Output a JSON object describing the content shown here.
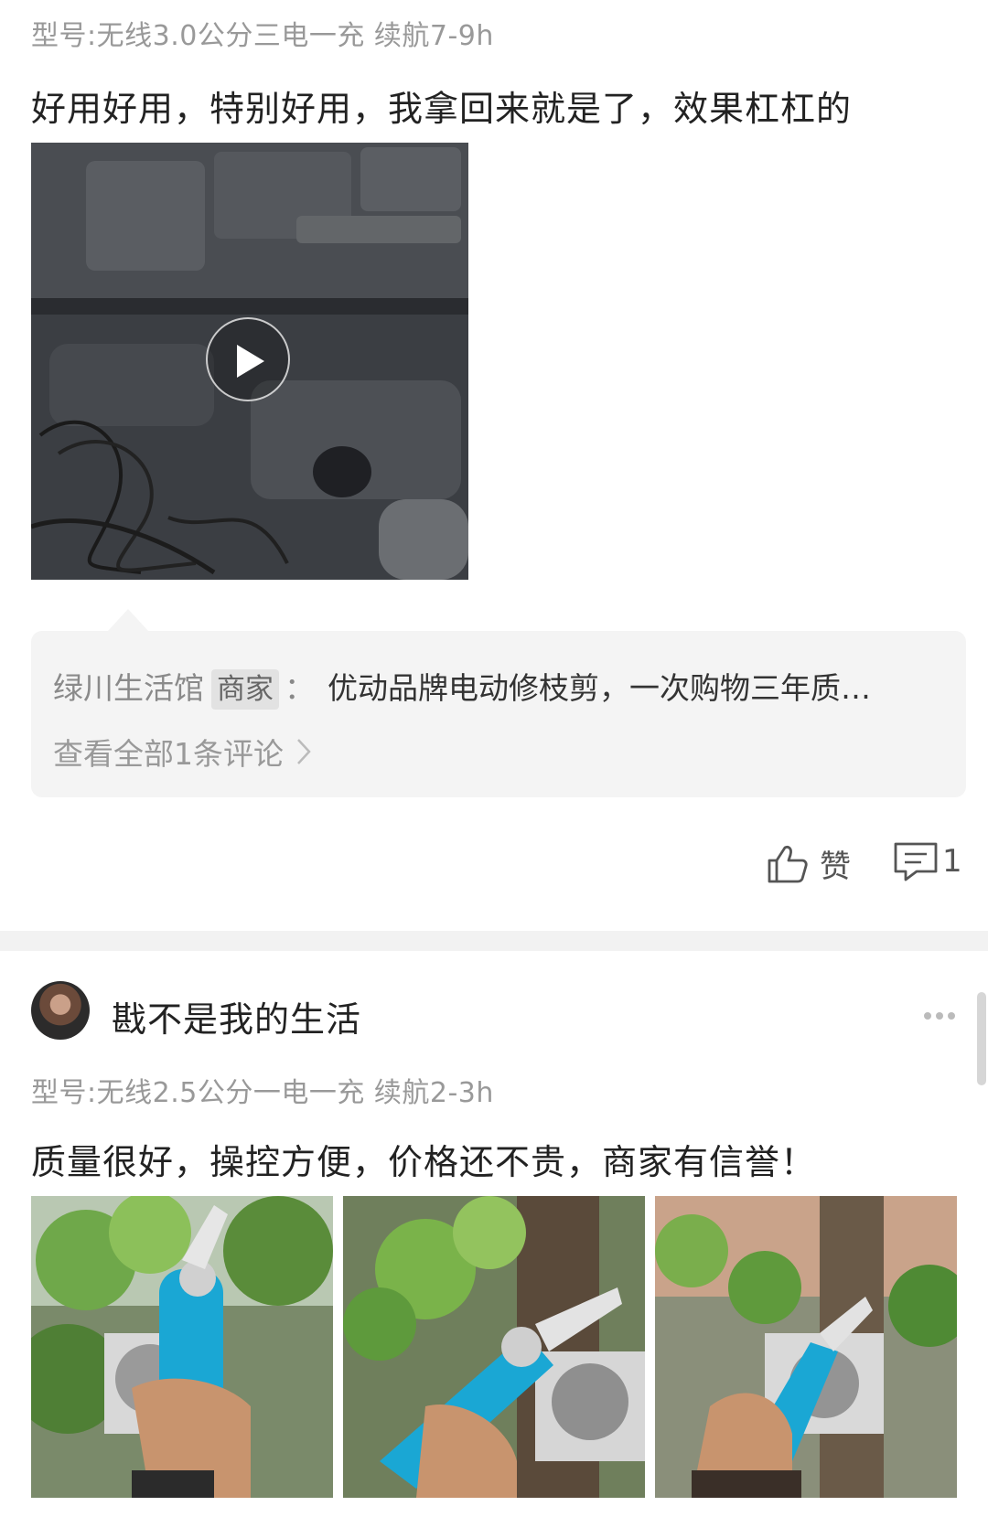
{
  "review1": {
    "spec": "型号:无线3.0公分三电一充 续航7-9h",
    "text": "好用好用，特别好用，我拿回来就是了，效果杠杠的",
    "video": {
      "play_icon": "play-icon"
    },
    "reply": {
      "author": "绿川生活馆",
      "tag": "商家",
      "colon": "：",
      "text": "优动品牌电动修枝剪，一次购物三年质…",
      "view_all": "查看全部1条评论"
    },
    "actions": {
      "like_label": "赞",
      "comment_count": "1"
    }
  },
  "review2": {
    "username": "戡不是我的生活",
    "spec": "型号:无线2.5公分一电一充 续航2-3h",
    "text": "质量很好，操控方便，价格还不贵，商家有信誉！",
    "photos": [
      "photo-1",
      "photo-2",
      "photo-3"
    ]
  },
  "colors": {
    "spec_gray": "#999999",
    "reply_bg": "#f4f4f4",
    "product_blue": "#1aa7d4"
  }
}
